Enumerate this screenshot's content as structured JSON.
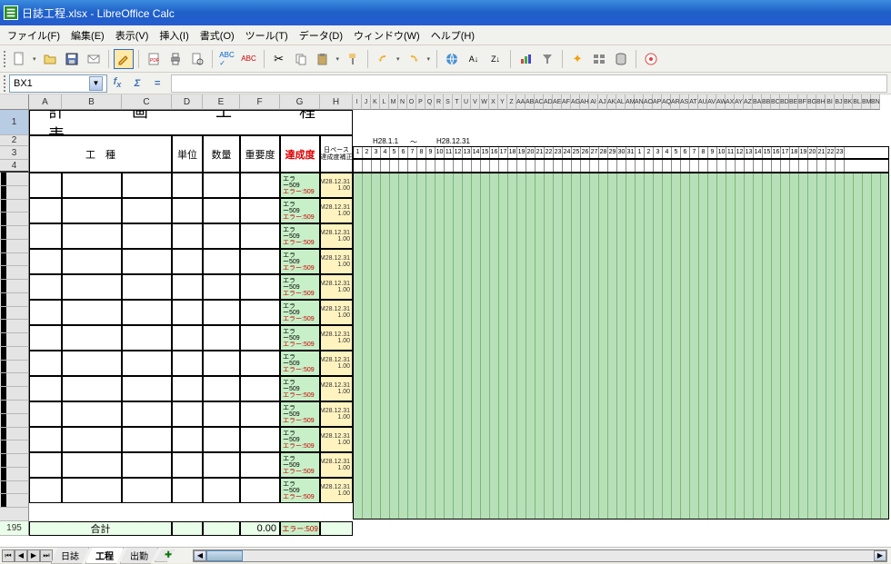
{
  "window": {
    "title": "日誌工程.xlsx - LibreOffice Calc"
  },
  "menu": {
    "file": "ファイル(F)",
    "edit": "編集(E)",
    "view": "表示(V)",
    "insert": "挿入(I)",
    "format": "書式(O)",
    "tools": "ツール(T)",
    "data": "データ(D)",
    "window": "ウィンドウ(W)",
    "help": "ヘルプ(H)"
  },
  "namebox": {
    "ref": "BX1"
  },
  "row1_title": "計　画　工　程　表",
  "headers": {
    "koushu": "工　種",
    "tani": "単位",
    "suuryou": "数量",
    "juuyoudo": "重要度",
    "tassei": "達成度",
    "hipace": "日ペース\n達成度補正"
  },
  "date_range": {
    "from": "H28.1.1",
    "tilde": "～",
    "to": "H28.12.31"
  },
  "day_numbers_1": [
    1,
    2,
    3,
    4,
    5,
    6,
    7,
    8,
    9,
    10,
    11,
    12,
    13,
    14,
    15,
    16,
    17,
    18,
    19,
    20,
    21,
    22,
    23,
    24,
    25,
    26,
    27,
    28,
    29,
    30,
    31
  ],
  "day_numbers_2": [
    1,
    2,
    3,
    4,
    5,
    6,
    7,
    8,
    9,
    10,
    11,
    12,
    13,
    14,
    15,
    16,
    17,
    18,
    19,
    20,
    21,
    22,
    23
  ],
  "err_rows": [
    {
      "e1": "エラ",
      "e2": "ー509",
      "e3": "エラー:509",
      "d1": "M28.12.31",
      "d2": "1.00"
    },
    {
      "e1": "エラ",
      "e2": "ー509",
      "e3": "エラー:509",
      "d1": "M28.12.31",
      "d2": "1.00"
    },
    {
      "e1": "エラ",
      "e2": "ー509",
      "e3": "エラー:509",
      "d1": "M28.12.31",
      "d2": "1.00"
    },
    {
      "e1": "エラ",
      "e2": "ー509",
      "e3": "エラー:509",
      "d1": "M28.12.31",
      "d2": "1.00"
    },
    {
      "e1": "エラ",
      "e2": "ー509",
      "e3": "エラー:509",
      "d1": "M28.12.31",
      "d2": "1.00"
    },
    {
      "e1": "エラ",
      "e2": "ー509",
      "e3": "エラー:509",
      "d1": "M28.12.31",
      "d2": "1.00"
    },
    {
      "e1": "エラ",
      "e2": "ー509",
      "e3": "エラー:509",
      "d1": "M28.12.31",
      "d2": "1.00"
    },
    {
      "e1": "エラ",
      "e2": "ー509",
      "e3": "エラー:509",
      "d1": "M28.12.31",
      "d2": "1.00"
    },
    {
      "e1": "エラ",
      "e2": "ー509",
      "e3": "エラー:509",
      "d1": "M28.12.31",
      "d2": "1.00"
    },
    {
      "e1": "エラ",
      "e2": "ー509",
      "e3": "エラー:509",
      "d1": "M28.12.31",
      "d2": "1.00"
    },
    {
      "e1": "エラ",
      "e2": "ー509",
      "e3": "エラー:509",
      "d1": "M28.12.31",
      "d2": "1.00"
    },
    {
      "e1": "エラ",
      "e2": "ー509",
      "e3": "エラー:509",
      "d1": "M28.12.31",
      "d2": "1.00"
    },
    {
      "e1": "エラ",
      "e2": "ー509",
      "e3": "エラー:509",
      "d1": "M28.12.31",
      "d2": "1.00"
    }
  ],
  "total": {
    "label": "合計",
    "juuyoudo": "0.00",
    "tassei": "エラー:509"
  },
  "total_rownum": "195",
  "tabs": {
    "t1": "日誌",
    "t2": "工程",
    "t3": "出勤"
  },
  "cols_far": [
    "I",
    "J",
    "K",
    "L",
    "M",
    "N",
    "O",
    "P",
    "Q",
    "R",
    "S",
    "T",
    "U",
    "V",
    "W",
    "X",
    "Y",
    "Z",
    "AA",
    "AB",
    "AC",
    "AD",
    "AE",
    "AF",
    "AG",
    "AH",
    "AI",
    "AJ",
    "AK",
    "AL",
    "AM",
    "AN",
    "AO",
    "AP",
    "AQ",
    "AR",
    "AS",
    "AT",
    "AU",
    "AV",
    "AW",
    "AX",
    "AY",
    "AZ",
    "BA",
    "BB",
    "BC",
    "BD",
    "BE",
    "BF",
    "BG",
    "BH",
    "BI",
    "BJ",
    "BK",
    "BL",
    "BM",
    "BN"
  ]
}
